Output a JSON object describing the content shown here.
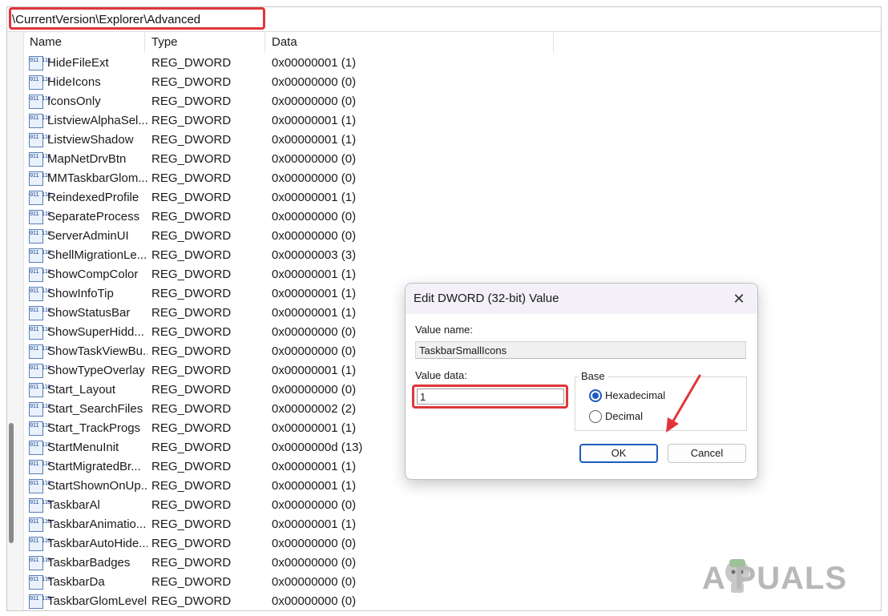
{
  "address_bar": {
    "path": "\\CurrentVersion\\Explorer\\Advanced"
  },
  "columns": {
    "name": "Name",
    "type": "Type",
    "data": "Data"
  },
  "rows": [
    {
      "name": "HideFileExt",
      "type": "REG_DWORD",
      "data": "0x00000001 (1)"
    },
    {
      "name": "HideIcons",
      "type": "REG_DWORD",
      "data": "0x00000000 (0)"
    },
    {
      "name": "IconsOnly",
      "type": "REG_DWORD",
      "data": "0x00000000 (0)"
    },
    {
      "name": "ListviewAlphaSel...",
      "type": "REG_DWORD",
      "data": "0x00000001 (1)"
    },
    {
      "name": "ListviewShadow",
      "type": "REG_DWORD",
      "data": "0x00000001 (1)"
    },
    {
      "name": "MapNetDrvBtn",
      "type": "REG_DWORD",
      "data": "0x00000000 (0)"
    },
    {
      "name": "MMTaskbarGlom...",
      "type": "REG_DWORD",
      "data": "0x00000000 (0)"
    },
    {
      "name": "ReindexedProfile",
      "type": "REG_DWORD",
      "data": "0x00000001 (1)"
    },
    {
      "name": "SeparateProcess",
      "type": "REG_DWORD",
      "data": "0x00000000 (0)"
    },
    {
      "name": "ServerAdminUI",
      "type": "REG_DWORD",
      "data": "0x00000000 (0)"
    },
    {
      "name": "ShellMigrationLe...",
      "type": "REG_DWORD",
      "data": "0x00000003 (3)"
    },
    {
      "name": "ShowCompColor",
      "type": "REG_DWORD",
      "data": "0x00000001 (1)"
    },
    {
      "name": "ShowInfoTip",
      "type": "REG_DWORD",
      "data": "0x00000001 (1)"
    },
    {
      "name": "ShowStatusBar",
      "type": "REG_DWORD",
      "data": "0x00000001 (1)"
    },
    {
      "name": "ShowSuperHidd...",
      "type": "REG_DWORD",
      "data": "0x00000000 (0)"
    },
    {
      "name": "ShowTaskViewBu...",
      "type": "REG_DWORD",
      "data": "0x00000000 (0)"
    },
    {
      "name": "ShowTypeOverlay",
      "type": "REG_DWORD",
      "data": "0x00000001 (1)"
    },
    {
      "name": "Start_Layout",
      "type": "REG_DWORD",
      "data": "0x00000000 (0)"
    },
    {
      "name": "Start_SearchFiles",
      "type": "REG_DWORD",
      "data": "0x00000002 (2)"
    },
    {
      "name": "Start_TrackProgs",
      "type": "REG_DWORD",
      "data": "0x00000001 (1)"
    },
    {
      "name": "StartMenuInit",
      "type": "REG_DWORD",
      "data": "0x0000000d (13)"
    },
    {
      "name": "StartMigratedBr...",
      "type": "REG_DWORD",
      "data": "0x00000001 (1)"
    },
    {
      "name": "StartShownOnUp...",
      "type": "REG_DWORD",
      "data": "0x00000001 (1)"
    },
    {
      "name": "TaskbarAl",
      "type": "REG_DWORD",
      "data": "0x00000000 (0)"
    },
    {
      "name": "TaskbarAnimatio...",
      "type": "REG_DWORD",
      "data": "0x00000001 (1)"
    },
    {
      "name": "TaskbarAutoHide...",
      "type": "REG_DWORD",
      "data": "0x00000000 (0)"
    },
    {
      "name": "TaskbarBadges",
      "type": "REG_DWORD",
      "data": "0x00000000 (0)"
    },
    {
      "name": "TaskbarDa",
      "type": "REG_DWORD",
      "data": "0x00000000 (0)"
    },
    {
      "name": "TaskbarGlomLevel",
      "type": "REG_DWORD",
      "data": "0x00000000 (0)"
    }
  ],
  "row_icon": {
    "name": "dword-value-icon",
    "glyph": "011\n110"
  },
  "dialog": {
    "title": "Edit DWORD (32-bit) Value",
    "close_glyph": "✕",
    "value_name_label": "Value name:",
    "value_name": "TaskbarSmallIcons",
    "value_data_label": "Value data:",
    "value_data": "1",
    "base_label": "Base",
    "hex_label": "Hexadecimal",
    "dec_label": "Decimal",
    "selected_base": "Hexadecimal",
    "ok_label": "OK",
    "cancel_label": "Cancel"
  },
  "colors": {
    "highlight": "#e0363b",
    "accent": "#1f5bbf"
  },
  "watermark": {
    "text": "A  PUALS"
  }
}
